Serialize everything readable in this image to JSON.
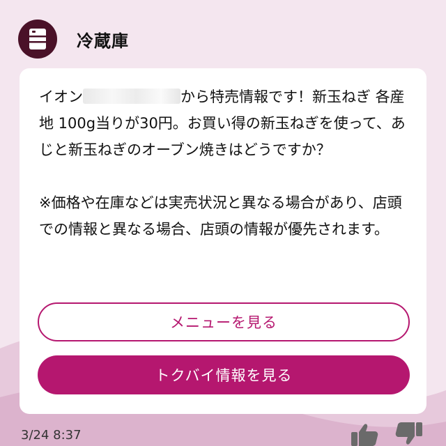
{
  "sender": {
    "name": "冷蔵庫",
    "avatar_icon": "fridge-icon"
  },
  "message": {
    "prefix": "イオン",
    "redacted_store": "",
    "line1_suffix": "から特売情報です！新玉ね",
    "body_rest": "ぎ 各産地 100g当りが30円。お買い得の新玉ねぎを使って、あじと新玉ねぎのオーブン焼きはどうですか？",
    "note": "※価格や在庫などは実売状況と異なる場合があり、店頭での情報と異なる場合、店頭の情報が優先されます。"
  },
  "buttons": {
    "menu_label": "メニューを見る",
    "tokubai_label": "トクバイ情報を見る"
  },
  "timestamp": "3/24 8:37",
  "reactions": {
    "up_icon": "thumbs-up-icon",
    "down_icon": "thumbs-down-icon"
  },
  "colors": {
    "accent": "#b5176f",
    "avatar_bg": "#4a1128",
    "background": "#f4e6ef"
  }
}
